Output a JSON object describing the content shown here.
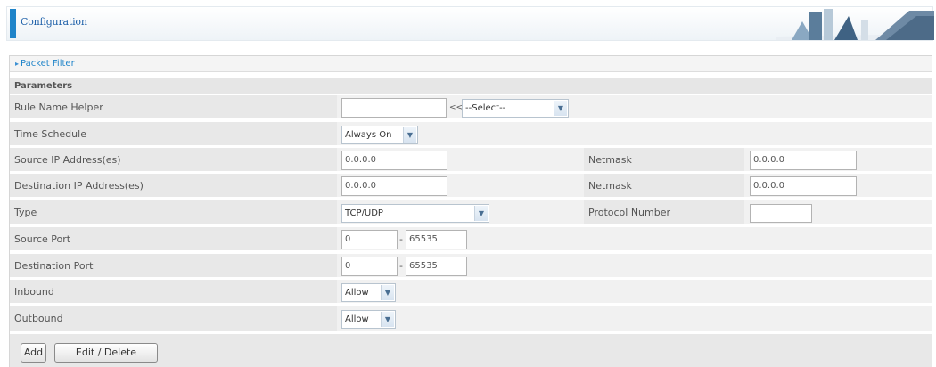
{
  "header": {
    "title": "Configuration"
  },
  "panel": {
    "title": "Packet Filter",
    "section": "Parameters"
  },
  "form": {
    "rule_name_helper": {
      "label": "Rule Name  Helper",
      "value": "",
      "separator": "<<",
      "helper_select": "--Select--"
    },
    "time_schedule": {
      "label": "Time Schedule",
      "value": "Always On"
    },
    "source_ip": {
      "label": "Source IP Address(es)",
      "value": "0.0.0.0",
      "netmask_label": "Netmask",
      "netmask": "0.0.0.0"
    },
    "destination_ip": {
      "label": "Destination IP Address(es)",
      "value": "0.0.0.0",
      "netmask_label": "Netmask",
      "netmask": "0.0.0.0"
    },
    "type": {
      "label": "Type",
      "value": "TCP/UDP",
      "protocol_label": "Protocol Number",
      "protocol_value": ""
    },
    "source_port": {
      "label": "Source Port",
      "from": "0",
      "separator": "-",
      "to": "65535"
    },
    "destination_port": {
      "label": "Destination Port",
      "from": "0",
      "separator": "-",
      "to": "65535"
    },
    "inbound": {
      "label": "Inbound",
      "value": "Allow"
    },
    "outbound": {
      "label": "Outbound",
      "value": "Allow"
    }
  },
  "buttons": {
    "add": "Add",
    "edit_delete": "Edit / Delete"
  },
  "colors": {
    "accent": "#1f84c9",
    "label_bg": "#e8e8e8",
    "value_bg": "#f1f1f1"
  }
}
